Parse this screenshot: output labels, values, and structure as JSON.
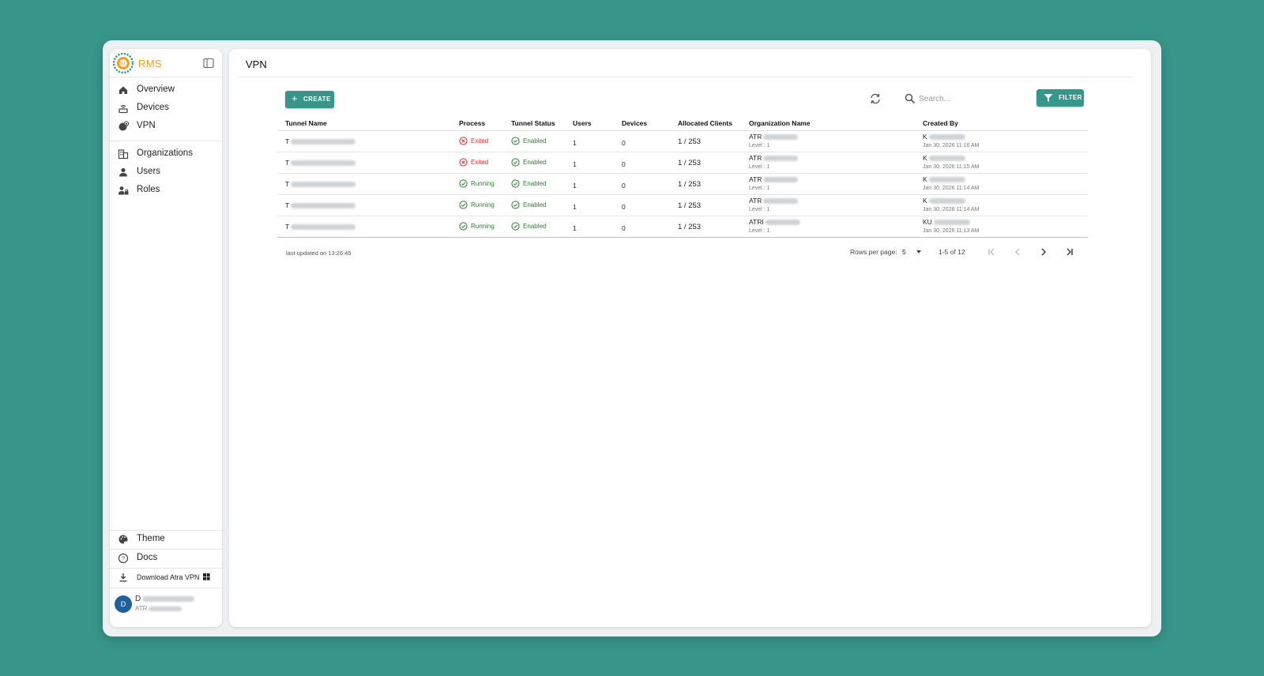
{
  "brand": {
    "name": "RMS",
    "accent": "#38958a",
    "brand_color": "#f0a020"
  },
  "sidebar": {
    "nav": [
      {
        "label": "Overview",
        "icon": "home-icon"
      },
      {
        "label": "Devices",
        "icon": "router-icon"
      },
      {
        "label": "VPN",
        "icon": "vpn-globe-icon"
      }
    ],
    "admin": [
      {
        "label": "Organizations",
        "icon": "building-icon"
      },
      {
        "label": "Users",
        "icon": "person-icon"
      },
      {
        "label": "Roles",
        "icon": "roles-icon"
      }
    ],
    "bottom": [
      {
        "label": "Theme",
        "icon": "palette-icon"
      },
      {
        "label": "Docs",
        "icon": "help-icon"
      },
      {
        "label": "Download Atra VPN",
        "icon": "download-icon"
      }
    ],
    "user": {
      "initials": "D",
      "name": "D",
      "org": "ATR"
    }
  },
  "page": {
    "title": "VPN"
  },
  "toolbar": {
    "create_label": "CREATE",
    "search_placeholder": "Search...",
    "filter_label": "FILTER"
  },
  "table": {
    "columns": [
      "Tunnel Name",
      "Process",
      "Tunnel Status",
      "Users",
      "Devices",
      "Allocated Clients",
      "Organization Name",
      "Created By"
    ],
    "rows": [
      {
        "tunnel": "T",
        "process": "Exited",
        "status": "Enabled",
        "users": "1",
        "devices": "0",
        "clients": "1 / 253",
        "org": "ATR",
        "org_level": "Level : 1",
        "creator": "K",
        "created": "Jan 30, 2026 11:16 AM"
      },
      {
        "tunnel": "T",
        "process": "Exited",
        "status": "Enabled",
        "users": "1",
        "devices": "0",
        "clients": "1 / 253",
        "org": "ATR",
        "org_level": "Level : 1",
        "creator": "K",
        "created": "Jan 30, 2026 11:15 AM"
      },
      {
        "tunnel": "T",
        "process": "Running",
        "status": "Enabled",
        "users": "1",
        "devices": "0",
        "clients": "1 / 253",
        "org": "ATR",
        "org_level": "Level : 1",
        "creator": "K",
        "created": "Jan 30, 2026 11:14 AM"
      },
      {
        "tunnel": "T",
        "process": "Running",
        "status": "Enabled",
        "users": "1",
        "devices": "0",
        "clients": "1 / 253",
        "org": "ATR",
        "org_level": "Level : 1",
        "creator": "K",
        "created": "Jan 30, 2026 11:14 AM"
      },
      {
        "tunnel": "T",
        "process": "Running",
        "status": "Enabled",
        "users": "1",
        "devices": "0",
        "clients": "1 / 253",
        "org": "ATRI",
        "org_level": "Level : 1",
        "creator": "KU",
        "created": "Jan 30, 2026 11:13 AM"
      }
    ]
  },
  "footer": {
    "last_updated": "last updated on 13:26:45",
    "rows_per_page_label": "Rows per page:",
    "rows_per_page": "5",
    "range": "1-5 of 12"
  }
}
